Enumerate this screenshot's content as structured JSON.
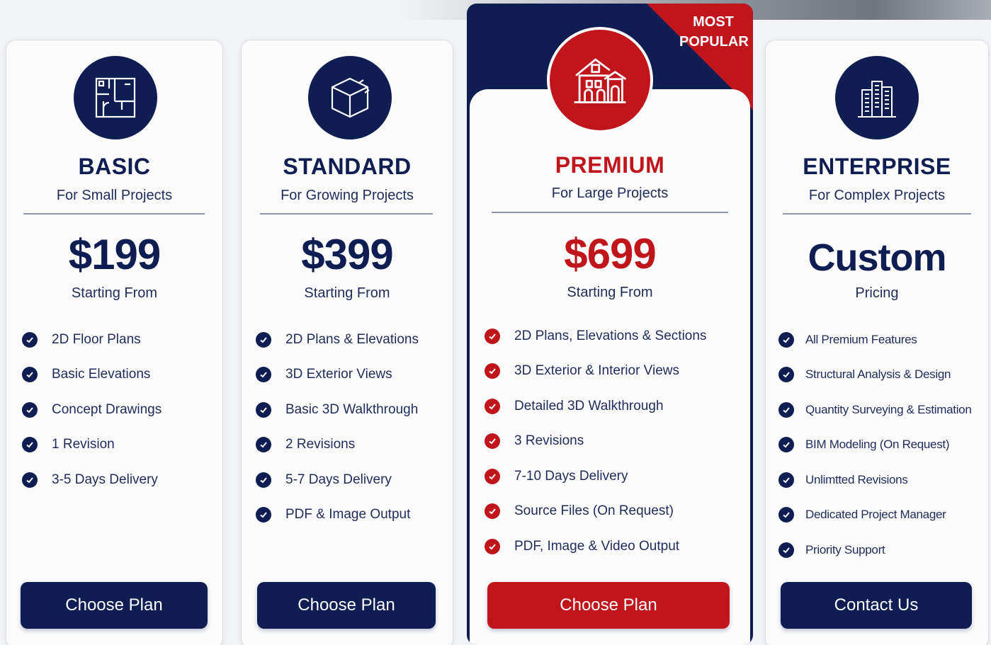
{
  "colors": {
    "navy": "#0f1d52",
    "red": "#c0161b",
    "card": "#fbfbfc"
  },
  "plans": [
    {
      "icon": "floor-plan-icon",
      "name": "BASIC",
      "subtitle": "For Small Projects",
      "price": "$199",
      "price_note": "Starting From",
      "features": [
        "2D Floor Plans",
        "Basic Elevations",
        "Concept Drawings",
        "1 Revision",
        "3-5 Days Delivery"
      ],
      "button": "Choose Plan"
    },
    {
      "icon": "cube-icon",
      "name": "STANDARD",
      "subtitle": "For Growing Projects",
      "price": "$399",
      "price_note": "Starting From",
      "features": [
        "2D Plans & Elevations",
        "3D Exterior Views",
        "Basic 3D Walkthrough",
        "2 Revisions",
        "5-7 Days Delivery",
        "PDF & Image Output"
      ],
      "button": "Choose Plan"
    },
    {
      "icon": "house-icon",
      "badge": [
        "MOST",
        "POPULAR"
      ],
      "name": "PREMIUM",
      "subtitle": "For Large Projects",
      "price": "$699",
      "price_note": "Starting From",
      "features": [
        "2D Plans, Elevations & Sections",
        "3D Exterior & Interior Views",
        "Detailed 3D Walkthrough",
        "3 Revisions",
        "7-10 Days Delivery",
        "Source Files (On Request)",
        "PDF, Image & Video Output"
      ],
      "button": "Choose Plan"
    },
    {
      "icon": "office-building-icon",
      "name": "ENTERPRISE",
      "subtitle": "For Complex Projects",
      "price": "Custom",
      "price_note": "Pricing",
      "features": [
        "All Premium Features",
        "Structural Analysis & Design",
        "Quantity Surveying & Estimation",
        "BIM Modeling (On Request)",
        "Unlimtted Revisions",
        "Dedicated Project Manager",
        "Priority Support"
      ],
      "button": "Contact Us"
    }
  ]
}
